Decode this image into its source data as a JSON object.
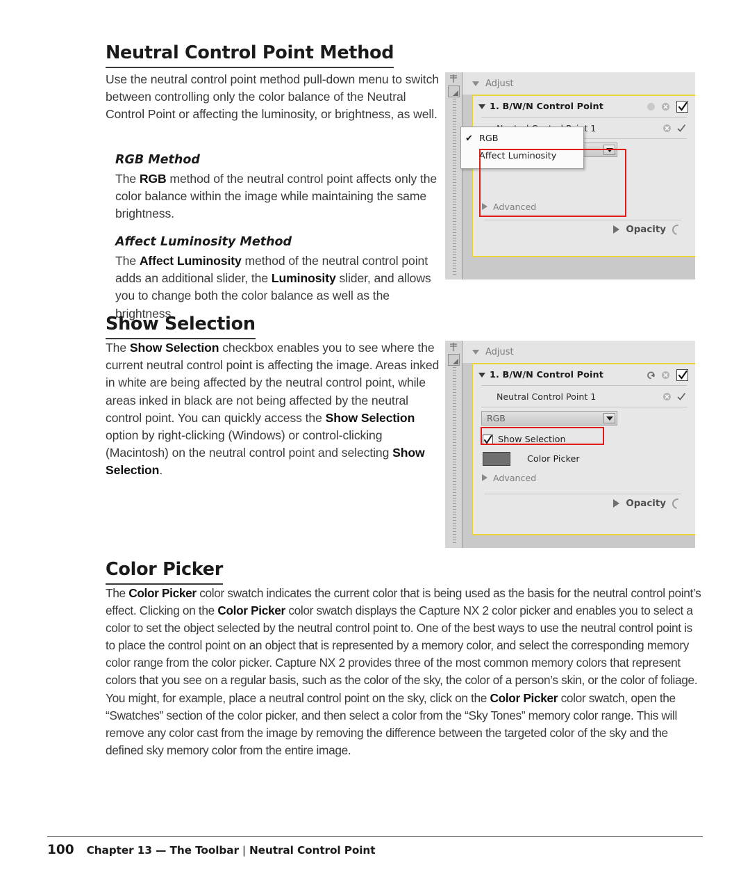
{
  "page": {
    "number": "100",
    "chapter": "Chapter 13 — The Toolbar",
    "separator": "|",
    "topic": "Neutral Control Point"
  },
  "sections": {
    "ncp": {
      "heading": "Neutral Control Point Method",
      "intro": "Use the neutral control point method pull-down menu to switch between controlling only the color balance of the Neutral Control Point or affecting the luminosity, or brightness, as well.",
      "rgb": {
        "heading": "RGB Method",
        "body_pre": "The ",
        "body_bold": "RGB",
        "body_post": " method of the neutral control point affects only the color balance within the image while maintaining the same brightness."
      },
      "affect": {
        "heading": "Affect Luminosity Method",
        "body_pre": "The ",
        "body_bold1": "Affect Luminosity",
        "body_mid": " method of the neutral control point adds an additional slider, the ",
        "body_bold2": "Luminosity",
        "body_post": " slider, and allows you to change both the color balance as well as the brightness."
      }
    },
    "show_selection": {
      "heading": "Show Selection",
      "body_pre": "The ",
      "body_bold1": "Show Selection",
      "body_mid1": " checkbox enables you to see where the current neutral control point is affecting the image. Areas inked in white are being affected by the neutral control point, while areas inked in black are not being affected by the neutral control point. You can quickly access the ",
      "body_bold2": "Show Selection",
      "body_mid2": " option by right-clicking (Windows) or control-clicking (Macintosh) on the neutral control point and selecting ",
      "body_bold3": "Show Selection",
      "body_post": "."
    },
    "color_picker": {
      "heading": "Color Picker",
      "body_pre": "The ",
      "body_bold1": "Color Picker",
      "body_mid1": " color swatch indicates the current color that is being used as the basis for the neutral control point’s effect. Clicking on the ",
      "body_bold2": "Color Picker",
      "body_mid2": " color swatch displays the Capture NX 2 color picker and enables you to select a color to set the object selected by the neutral control point to. One of the best ways to use the neutral control point is to place the control point on an object that is represented by a memory color, and select the corresponding memory color range from the color picker. Capture NX 2 provides three of the most common memory colors that represent colors that you see on a regular basis, such as the color of the sky, the color of a person’s skin, or the color of foliage. You might, for example, place a neutral control point on the sky, click on the ",
      "body_bold3": "Color Picker",
      "body_post": " color swatch, open the “Swatches” section of the color picker, and then select a color from the “Sky Tones” memory color range. This will remove any color cast from the image by removing the difference between the targeted color of the sky and the defined sky memory color from the entire image."
    }
  },
  "screenshot_1": {
    "adjust_label": "Adjust",
    "step_title": "1. B/W/N Control Point",
    "ncp_label": "Neutral Control Point 1",
    "combo_value": "RGB",
    "dropdown_items": [
      {
        "label": "RGB",
        "checked": "✔"
      },
      {
        "label": "Affect Luminosity",
        "checked": ""
      }
    ],
    "advanced_label": "Advanced",
    "opacity_label": "Opacity",
    "icons": {
      "reset": "reset-icon",
      "delete": "delete-icon",
      "enable": "enable-checkbox",
      "check_glyph": "✓"
    }
  },
  "screenshot_2": {
    "adjust_label": "Adjust",
    "step_title": "1. B/W/N Control Point",
    "ncp_label": "Neutral Control Point 1",
    "combo_value": "RGB",
    "show_selection_label": "Show Selection",
    "show_selection_checked": "✓",
    "color_picker_label": "Color Picker",
    "color_picker_swatch": "#6f6f6f",
    "advanced_label": "Advanced",
    "opacity_label": "Opacity"
  },
  "colors": {
    "highlight_red": "#e01b1b",
    "step_border_yellow": "#e8d43a",
    "panel_bg": "#e7e7e7",
    "app_bg": "#c9c9c9"
  }
}
